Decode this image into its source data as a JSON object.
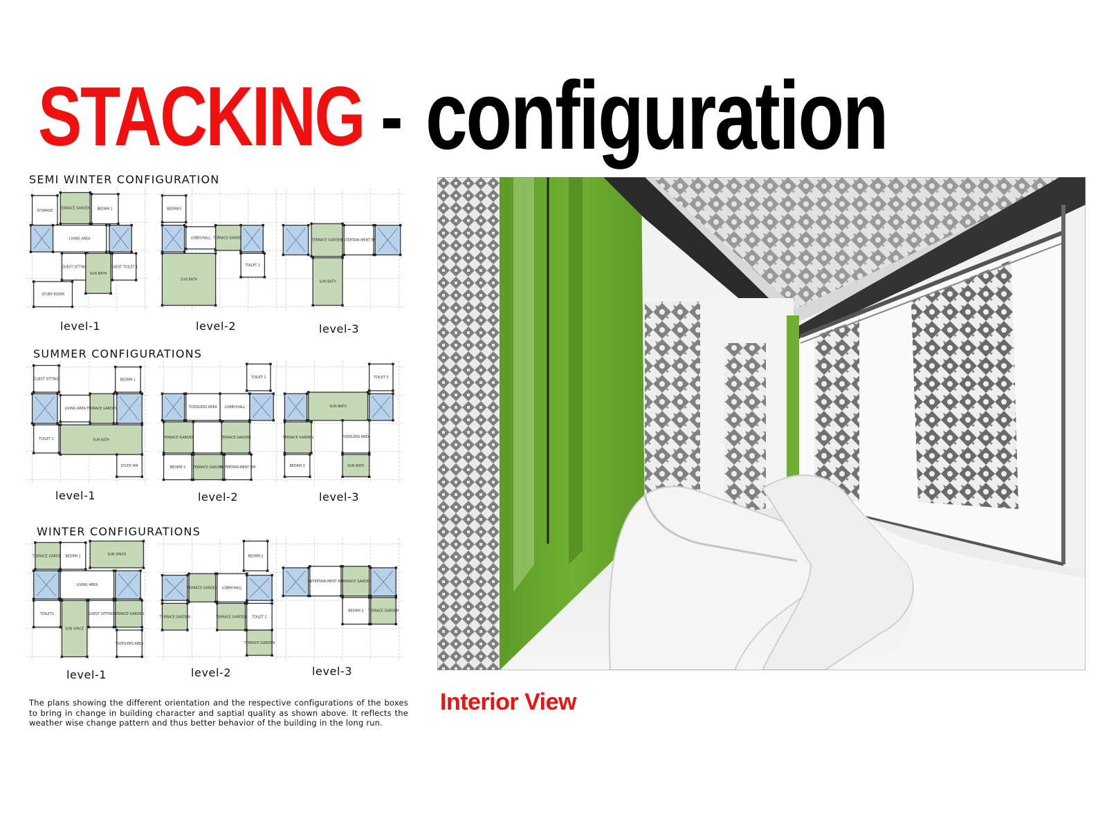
{
  "title": {
    "part_red": "STACKING",
    "part_dash": "-",
    "part_black": "configuration"
  },
  "colors": {
    "accent_red": "#f01010",
    "room_green": "#c6d9b6",
    "stair_blue": "#b9d2ea"
  },
  "sections": [
    {
      "title": "SEMI WINTER CONFIGURATION",
      "levels": [
        {
          "label": "level-1",
          "rooms": [
            "STORAGE",
            "TERRACE GARDEN",
            "BEDRM 1",
            "LIVING AREA",
            "GUEST SITTING",
            "GUEST TOILET 1",
            "STUDY ROOM",
            "SUN BATH"
          ]
        },
        {
          "label": "level-2",
          "rooms": [
            "BEDRM3",
            "LOBBY/HALL",
            "TERRACE GARDEN",
            "TOILET 2",
            "SUN BATH"
          ]
        },
        {
          "label": "level-3",
          "rooms": [
            "TERRACE GARDEN",
            "ENTERTAIN-MENT RM",
            "SUN BATH"
          ]
        }
      ]
    },
    {
      "title": "SUMMER CONFIGURATIONS",
      "levels": [
        {
          "label": "level-1",
          "rooms": [
            "GUEST SITTING",
            "BEDRM 1",
            "LIVING AREA",
            "TERRACE GARDEN",
            "TOILET 1",
            "SUN BATH",
            "STUDY RM"
          ]
        },
        {
          "label": "level-2",
          "rooms": [
            "TOILET 2",
            "TODDLERS AREA",
            "LOBBY/HALL",
            "TERRACE GARDEN",
            "TERRACE GARDEN",
            "BEDRM 3",
            "TERRACE GARDEN",
            "ENTERTAIN-MENT RM"
          ]
        },
        {
          "label": "level-3",
          "rooms": [
            "TOILET 3",
            "SUN BATH",
            "TERRACE GARDEN",
            "TODDLERS AREA",
            "BEDRM 3",
            "SUN BATH"
          ]
        }
      ]
    },
    {
      "title": "WINTER CONFIGURATIONS",
      "levels": [
        {
          "label": "level-1",
          "rooms": [
            "TERRACE GARDEN",
            "BEDRM 1",
            "SUN SPACE",
            "LIVING AREA",
            "TOILET1",
            "GUEST SITTING",
            "TERRACE GARDEN",
            "SUN SPACE",
            "TODDLERS AREA"
          ]
        },
        {
          "label": "level-2",
          "rooms": [
            "BEDRM 2",
            "TERRACE GARDEN",
            "LOBBY/HALL",
            "TERRACE GARDEN",
            "TERRACE GARDEN",
            "TOILET 2",
            "TERRACE GARDEN"
          ]
        },
        {
          "label": "level-3",
          "rooms": [
            "ENTERTAIN-MENT RM",
            "TERRACE GARDEN",
            "BEDRM 3",
            "TERRACE GARDEN"
          ]
        }
      ]
    }
  ],
  "caption": "The plans showing the different orientation and the respective configurations of the boxes to bring in change in building character and saptial quality as shown above. It reflects the weather wise change pattern and thus better behavior of the building in the long run.",
  "render_label": "Interior View"
}
